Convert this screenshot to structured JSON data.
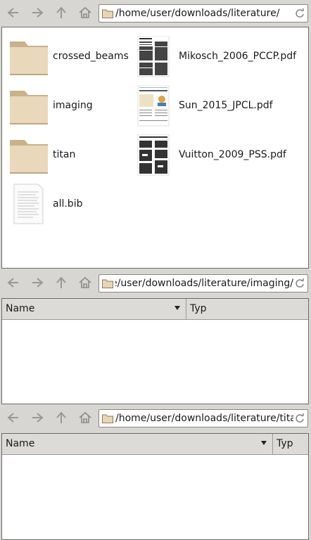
{
  "icons": {
    "back": "back-arrow-icon",
    "forward": "forward-arrow-icon",
    "up": "up-arrow-icon",
    "home": "home-icon",
    "folder": "folder-icon",
    "reload": "reload-icon",
    "pdf": "pdf-thumbnail-icon",
    "text": "text-document-icon"
  },
  "colors": {
    "folder": "#ddc9a5",
    "background": "#d8d6d2"
  },
  "pane1": {
    "path": "/home/user/downloads/literature/",
    "items": [
      {
        "label": "crossed_beams",
        "kind": "folder"
      },
      {
        "label": "imaging",
        "kind": "folder"
      },
      {
        "label": "titan",
        "kind": "folder"
      },
      {
        "label": "all.bib",
        "kind": "text"
      },
      {
        "label": "Mikosch_2006_PCCP.pdf",
        "kind": "pdf"
      },
      {
        "label": "Sun_2015_JPCL.pdf",
        "kind": "pdf"
      },
      {
        "label": "Vuitton_2009_PSS.pdf",
        "kind": "pdf"
      }
    ]
  },
  "pane2": {
    "path": "/home/user/downloads/literature/imaging/",
    "columns": [
      "Name",
      "Typ"
    ]
  },
  "pane3": {
    "path": "/home/user/downloads/literature/titan/",
    "columns": [
      "Name",
      "Typ"
    ]
  }
}
